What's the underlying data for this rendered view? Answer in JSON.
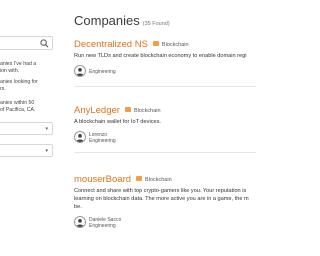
{
  "sidebar": {
    "search_value": "",
    "filters": [
      "anies I've had a\nion with.",
      "anies looking for\nrs.",
      "anies within 50\nof Pacifica, CA."
    ],
    "selects": [
      "",
      ""
    ]
  },
  "header": {
    "title": "Companies",
    "count": "(35 Found)"
  },
  "companies": [
    {
      "name": "Decentralized NS",
      "tag": "Blockchain",
      "description": "Run new TLDs and create blockchain economy to enable domain regi",
      "person_name": "",
      "person_role": "Engineering"
    },
    {
      "name": "AnyLedger",
      "tag": "Blockchain",
      "description": "A blockchain wallet for IoT devices.",
      "person_name": "Lorenzo",
      "person_role": "Engineering"
    },
    {
      "name": "mouserBoard",
      "tag": "Blockchain",
      "description": "Connect and share with top crypto-gamers like you. Your reputation is\nlearning on blockchain data. The more active you are in a game, the m\nbe.",
      "person_name": "Daniele Sacco",
      "person_role": "Engineering"
    }
  ],
  "colors": {
    "accent": "#e0731f",
    "tag": "#f0a040",
    "border": "#d7d7d7"
  },
  "icons": {
    "search": "search-icon",
    "tag": "tag-icon",
    "chevron": "chevron-down-icon",
    "avatar": "user-avatar-icon"
  }
}
